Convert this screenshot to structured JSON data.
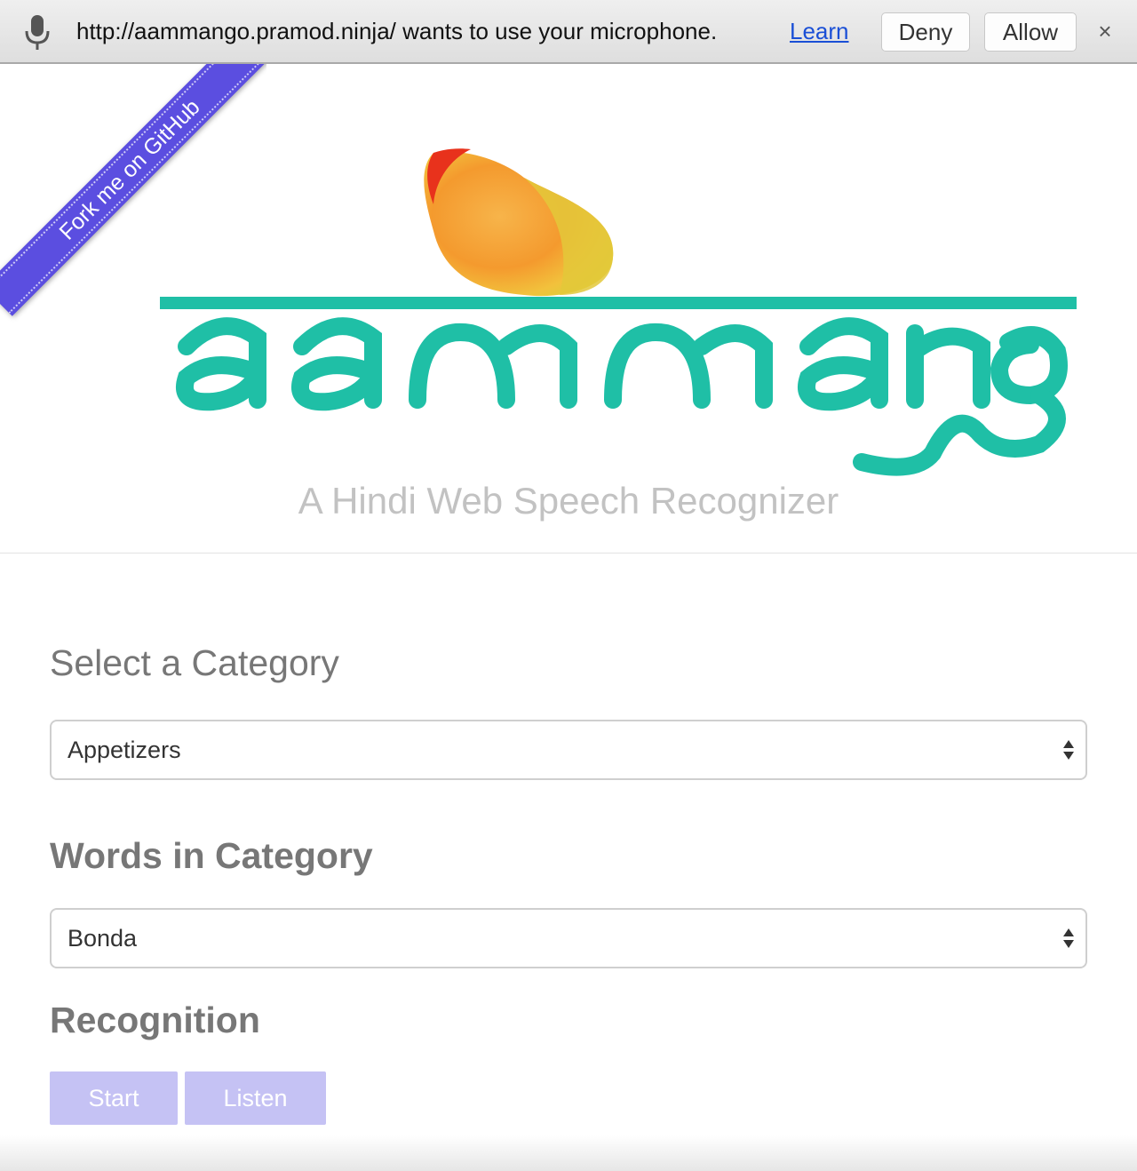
{
  "infobar": {
    "message": "http://aammango.pramod.ninja/ wants to use your microphone.",
    "learn_label": "Learn",
    "deny_label": "Deny",
    "allow_label": "Allow",
    "close_label": "×",
    "icons": {
      "mic": "microphone-icon"
    }
  },
  "ribbon": {
    "label": "Fork me on GitHub",
    "color": "#5b4ee0"
  },
  "header": {
    "logo_text": "aammango",
    "logo_color": "#1fbfa6",
    "tagline": "A Hindi Web Speech Recognizer"
  },
  "form": {
    "category_title": "Select a Category",
    "category_value": "Appetizers",
    "words_title": "Words in Category",
    "word_value": "Bonda",
    "recognition_title": "Recognition",
    "start_label": "Start",
    "listen_label": "Listen",
    "button_color": "#c5c2f4"
  }
}
